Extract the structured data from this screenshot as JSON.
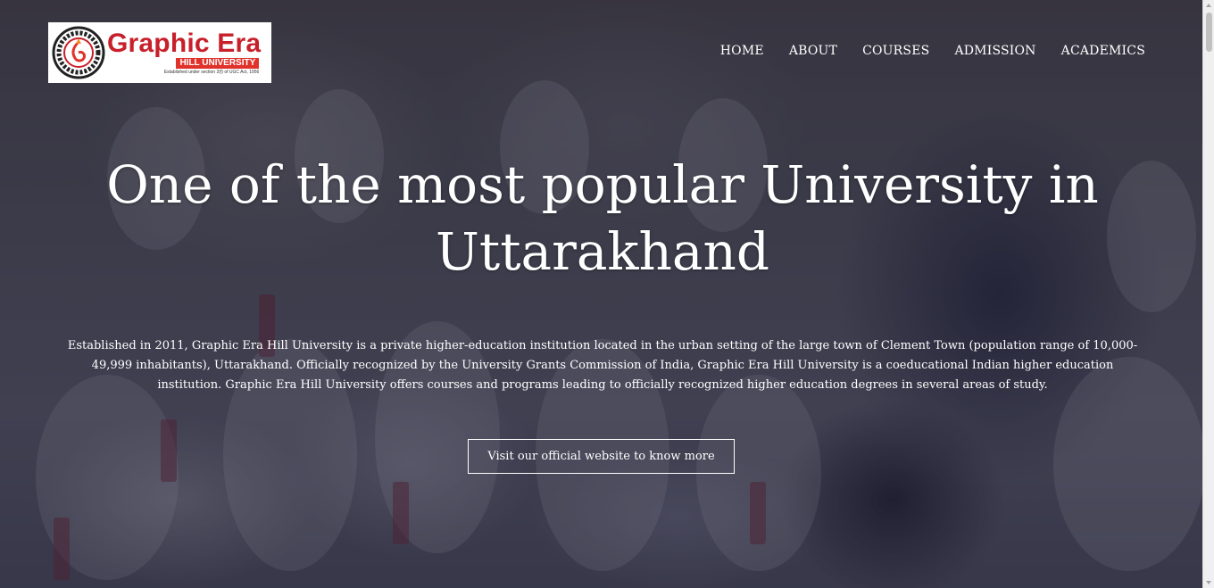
{
  "logo": {
    "name": "Graphic Era",
    "subtitle": "HILL UNIVERSITY",
    "tagline": "Established under section 2(f) of UGC Act, 1956",
    "brand_color": "#c8202b"
  },
  "nav": {
    "items": [
      {
        "label": "HOME"
      },
      {
        "label": "ABOUT"
      },
      {
        "label": "COURSES"
      },
      {
        "label": "ADMISSION"
      },
      {
        "label": "ACADEMICS"
      }
    ]
  },
  "hero": {
    "headline": "One of the most popular University in Uttarakhand",
    "description": "Established in 2011, Graphic Era Hill University is a private higher-education institution located in the urban setting of the large town of Clement Town (population range of 10,000-49,999 inhabitants), Uttarakhand. Officially recognized by the University Grants Commission of India, Graphic Era Hill University is a coeducational Indian higher education institution. Graphic Era Hill University offers courses and programs leading to officially recognized higher education degrees in several areas of study.",
    "cta_label": "Visit our official website to know more"
  }
}
